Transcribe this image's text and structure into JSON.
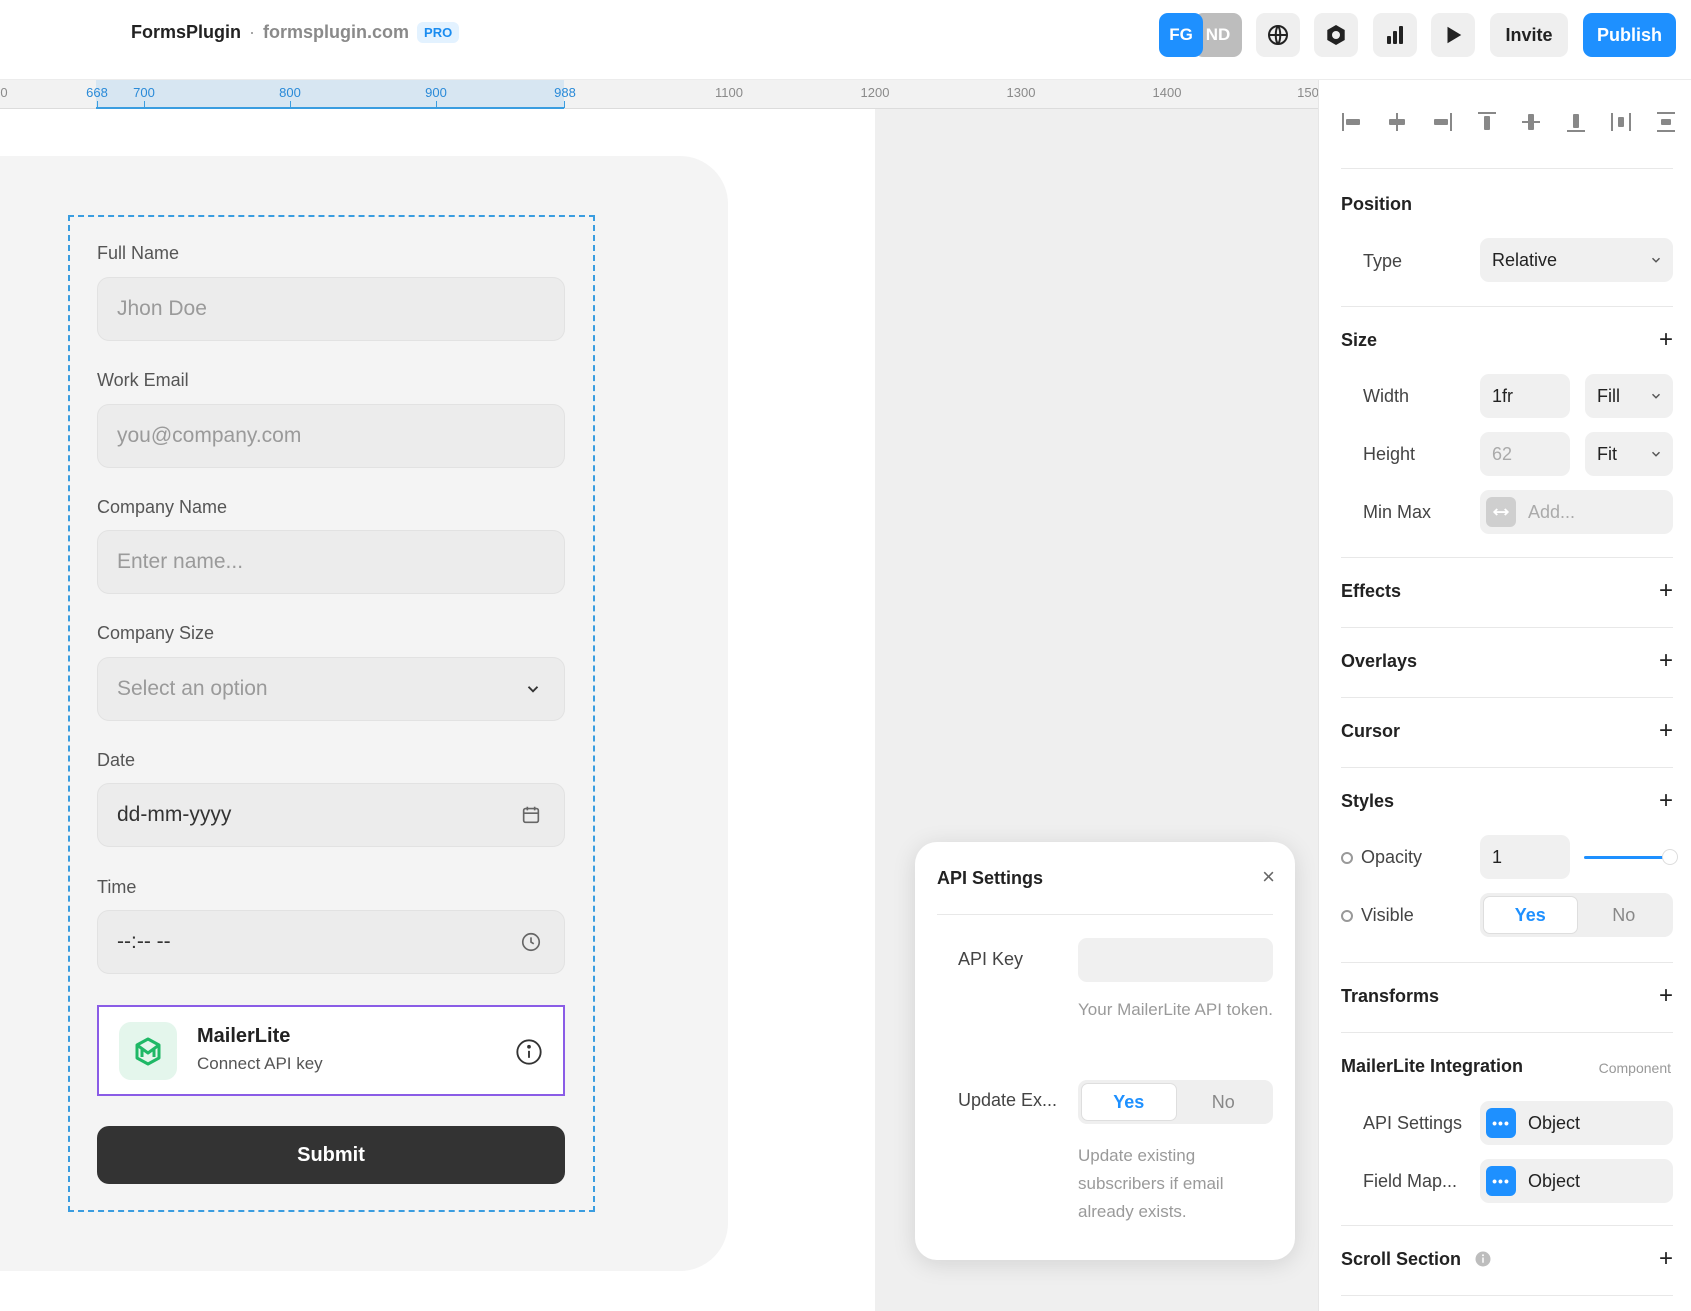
{
  "topbar": {
    "app_name": "FormsPlugin",
    "separator": "·",
    "domain": "formsplugin.com",
    "badge": "PRO",
    "avatars": [
      "FG",
      "ND"
    ],
    "icons": [
      "globe-icon",
      "settings-icon",
      "analytics-icon",
      "play-icon"
    ],
    "invite_label": "Invite",
    "publish_label": "Publish",
    "accent": "#1e90ff"
  },
  "ruler": {
    "ticks": [
      "668",
      "700",
      "800",
      "900",
      "988",
      "1100",
      "1200",
      "1300",
      "1400",
      "150"
    ],
    "left_edge": "0"
  },
  "form": {
    "fields": [
      {
        "label": "Full Name",
        "placeholder": "Jhon Doe"
      },
      {
        "label": "Work Email",
        "placeholder": "you@company.com"
      },
      {
        "label": "Company Name",
        "placeholder": "Enter name..."
      },
      {
        "label": "Company Size",
        "placeholder": "Select an option"
      },
      {
        "label": "Date",
        "value": "dd-mm-yyyy"
      },
      {
        "label": "Time",
        "value": "--:-- --"
      }
    ],
    "integration": {
      "title": "MailerLite",
      "subtitle": "Connect API key"
    },
    "submit_label": "Submit"
  },
  "api_popup": {
    "title": "API Settings",
    "close": "×",
    "api_key_label": "API Key",
    "api_key_value": "",
    "api_key_hint": "Your MailerLite API token.",
    "update_label": "Update Ex...",
    "update_options": [
      "Yes",
      "No"
    ],
    "update_selected": "Yes",
    "update_hint": "Update existing subscribers if email already exists."
  },
  "panel": {
    "position": {
      "heading": "Position",
      "type_label": "Type",
      "type_value": "Relative"
    },
    "size": {
      "heading": "Size",
      "width_label": "Width",
      "width_value": "1fr",
      "width_mode": "Fill",
      "height_label": "Height",
      "height_value": "62",
      "height_mode": "Fit",
      "minmax_label": "Min Max",
      "minmax_placeholder": "Add..."
    },
    "sections": [
      "Effects",
      "Overlays",
      "Cursor",
      "Styles"
    ],
    "styles": {
      "opacity_label": "Opacity",
      "opacity_value": "1",
      "opacity_level": 1.0,
      "visible_label": "Visible",
      "visible_options": [
        "Yes",
        "No"
      ],
      "visible_selected": "Yes"
    },
    "transforms": "Transforms",
    "integration": {
      "heading": "MailerLite Integration",
      "tag": "Component",
      "api_label": "API Settings",
      "api_value": "Object",
      "map_label": "Field Map...",
      "map_value": "Object"
    },
    "scroll": "Scroll Section",
    "plus": "+"
  }
}
